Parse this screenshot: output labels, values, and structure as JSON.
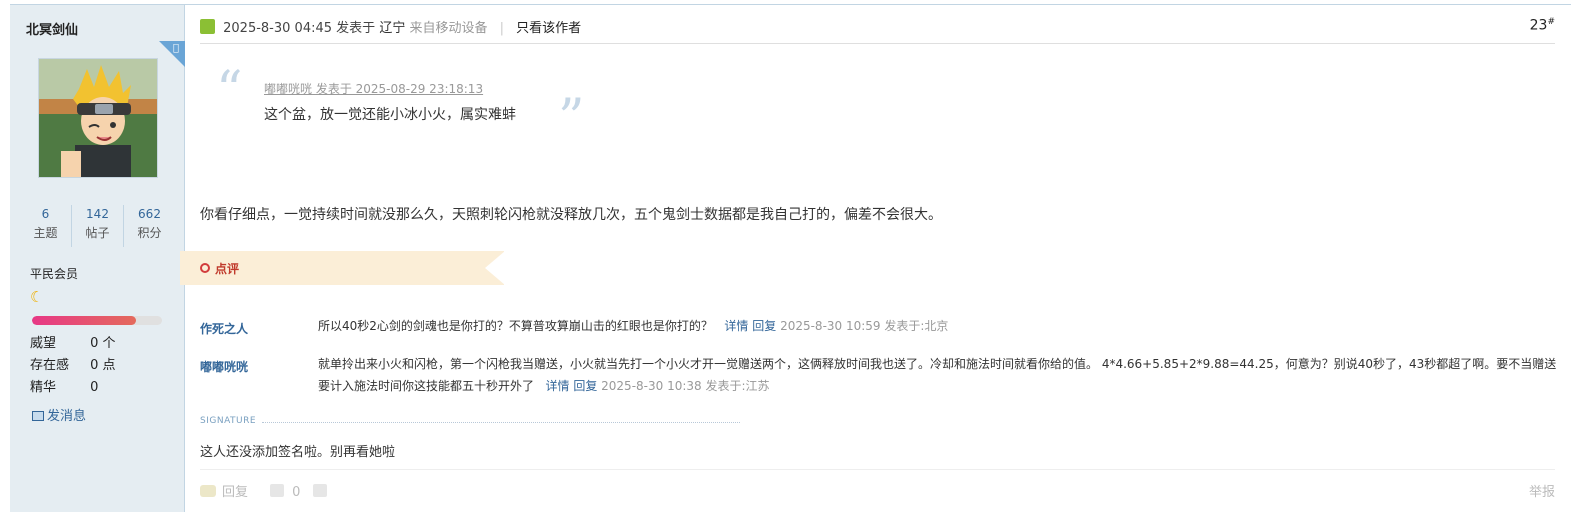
{
  "author": {
    "name": "北冥剑仙",
    "stats": [
      {
        "value": "6",
        "label": "主题"
      },
      {
        "value": "142",
        "label": "帖子"
      },
      {
        "value": "662",
        "label": "积分"
      }
    ],
    "group": "平民会员",
    "level_progress": 0.8,
    "attrs": [
      {
        "key": "威望",
        "value": "0 个"
      },
      {
        "key": "存在感",
        "value": "0 点"
      },
      {
        "key": "精华",
        "value": "0"
      }
    ],
    "send_message": "发消息"
  },
  "post": {
    "datetime": "2025-8-30 04:45",
    "posted_in": "发表于",
    "location": "辽宁",
    "mobile": "来自移动设备",
    "only_author": "只看该作者",
    "floor": "23",
    "floor_mark": "#",
    "quote": {
      "meta": "嘟嘟咣咣 发表于 2025-08-29 23:18:13",
      "text": "这个盆，放一觉还能小冰小火，属实难蚌"
    },
    "body": "你看仔细点，一觉持续时间就没那么久，天照刺轮闪枪就没释放几次，五个鬼剑士数据都是我自己打的，偏差不会很大。"
  },
  "comments_section": {
    "label": "点评",
    "items": [
      {
        "user": "作死之人",
        "text": "所以40秒2心剑的剑魂也是你打的？不算普攻算崩山击的红眼也是你打的？",
        "detail": "详情",
        "reply": "回复",
        "time": "2025-8-30 10:59 发表于:北京"
      },
      {
        "user": "嘟嘟咣咣",
        "text": "就单拎出来小火和闪枪，第一个闪枪我当赠送，小火就当先打一个小火才开一觉赠送两个，这俩释放时间我也送了。冷却和施法时间就看你给的值。 4*4.66+5.85+2*9.88=44.25，何意为？别说40秒了，43秒都超了啊。要不当赠送要计入施法时间你这技能都五十秒开外了",
        "detail": "详情",
        "reply": "回复",
        "time": "2025-8-30 10:38 发表于:江苏"
      }
    ]
  },
  "signature": {
    "label": "SIGNATURE",
    "text": "这人还没添加签名啦。别再看她啦"
  },
  "footer": {
    "reply": "回复",
    "like_count": "0",
    "report": "举报"
  }
}
